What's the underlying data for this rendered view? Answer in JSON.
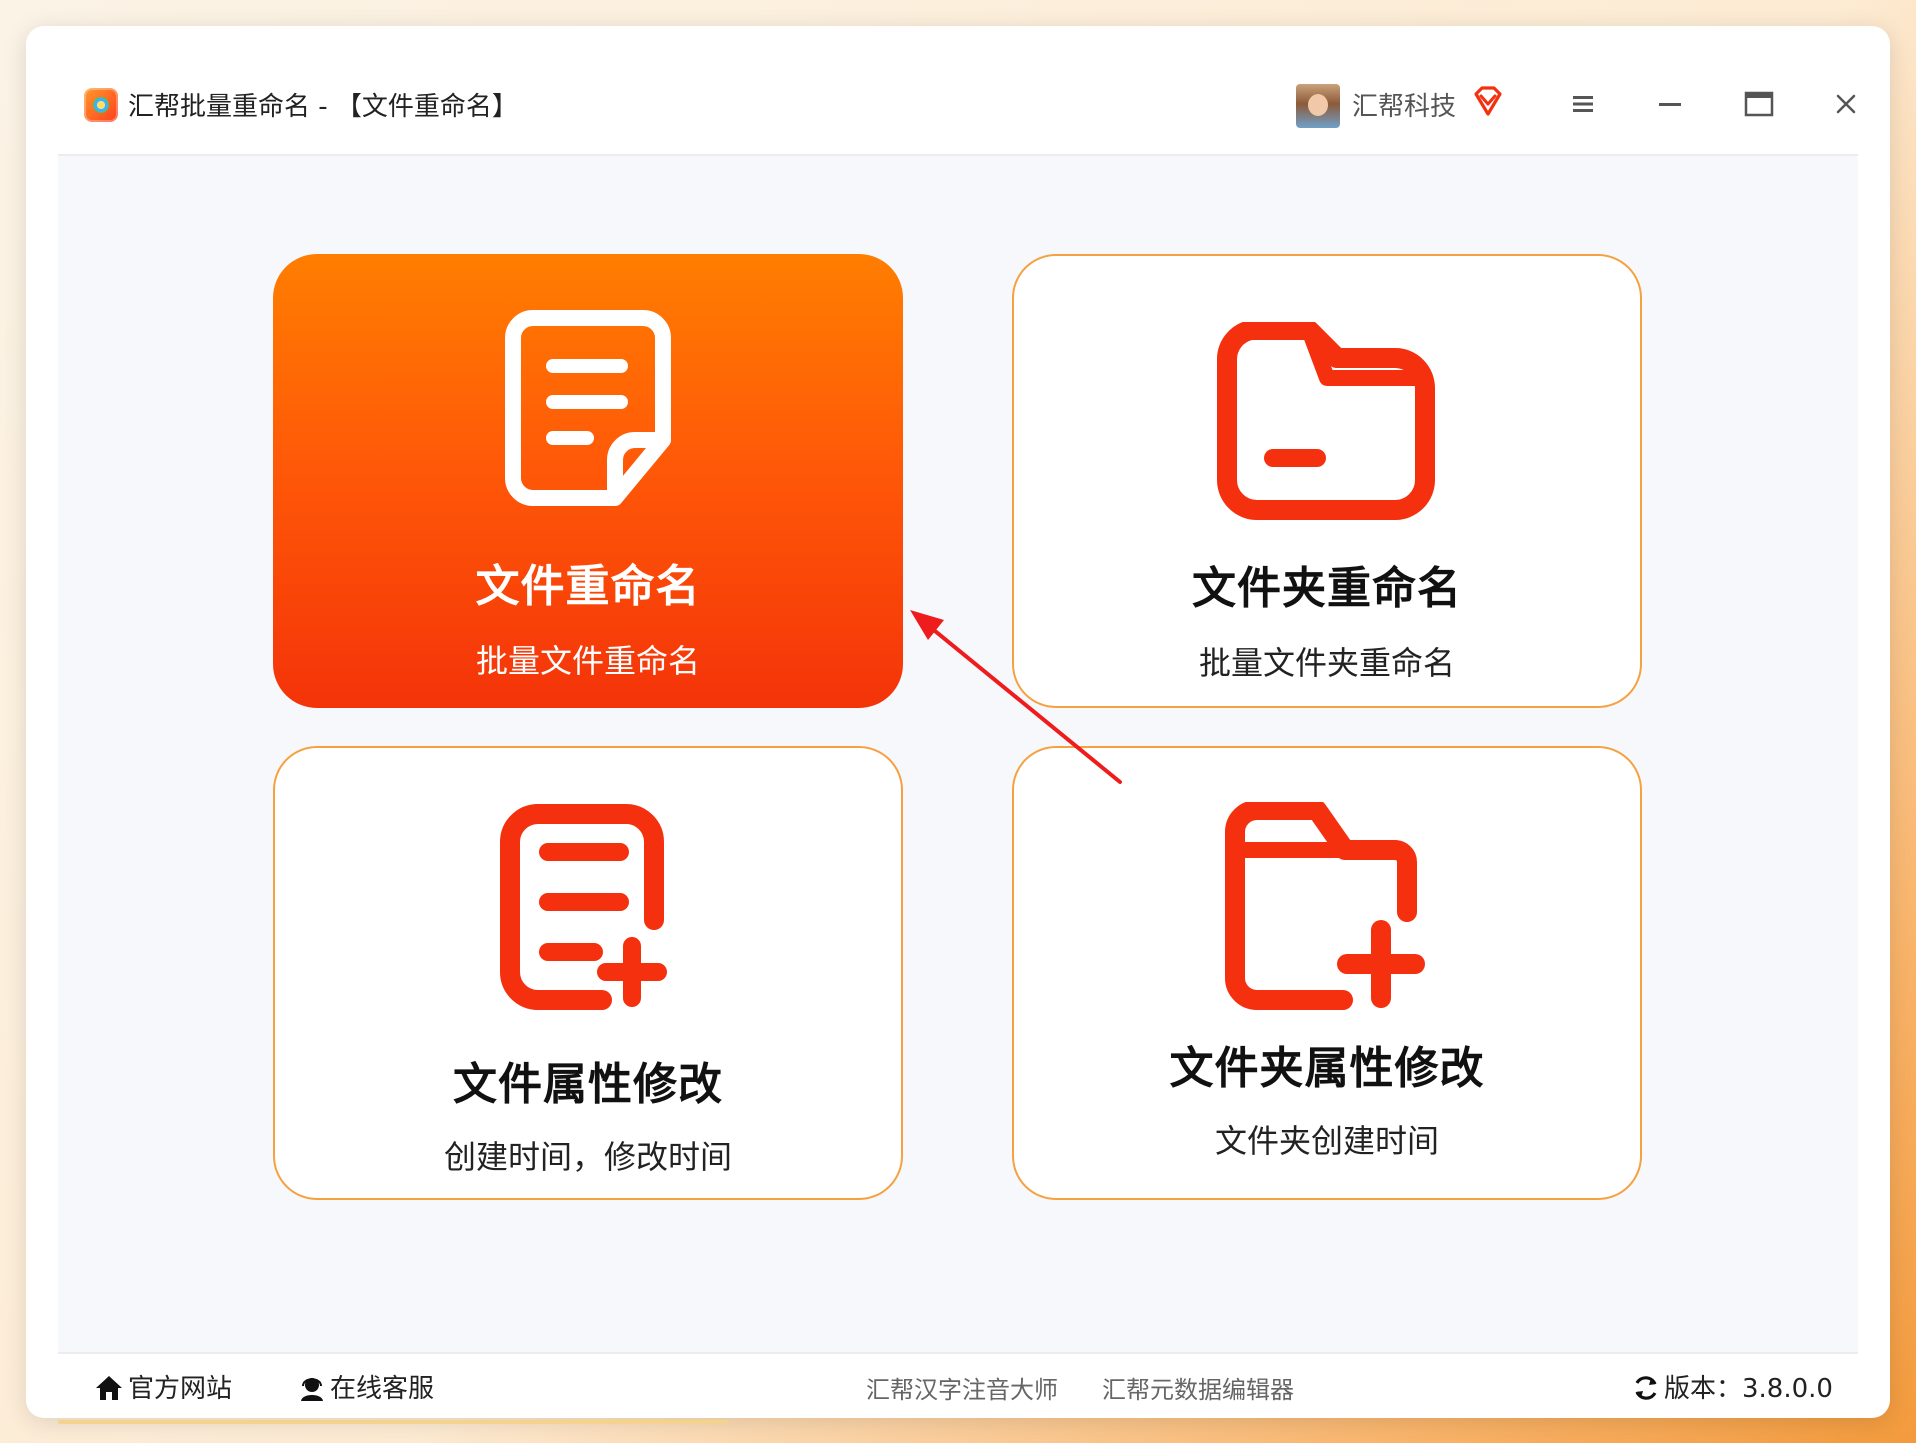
{
  "window": {
    "app_title": "汇帮批量重命名 - 【文件重命名】",
    "company": "汇帮科技",
    "controls": [
      "menu-icon",
      "minimize-icon",
      "maximize-icon",
      "close-icon"
    ]
  },
  "cards": [
    {
      "title": "文件重命名",
      "subtitle": "批量文件重命名",
      "icon": "document-icon",
      "active": true
    },
    {
      "title": "文件夹重命名",
      "subtitle": "批量文件夹重命名",
      "icon": "folder-icon",
      "active": false
    },
    {
      "title": "文件属性修改",
      "subtitle": "创建时间，修改时间",
      "icon": "document-add-icon",
      "active": false
    },
    {
      "title": "文件夹属性修改",
      "subtitle": "文件夹创建时间",
      "icon": "folder-add-icon",
      "active": false
    }
  ],
  "footer": {
    "website": "官方网站",
    "support": "在线客服",
    "link1": "汇帮汉字注音大师",
    "link2": "汇帮元数据编辑器",
    "version": "版本：3.8.0.0"
  },
  "colors": {
    "accent_orange": "#ff7e00",
    "accent_red": "#f43309",
    "icon_red": "#f5300f",
    "card_border": "#f5a13f"
  }
}
